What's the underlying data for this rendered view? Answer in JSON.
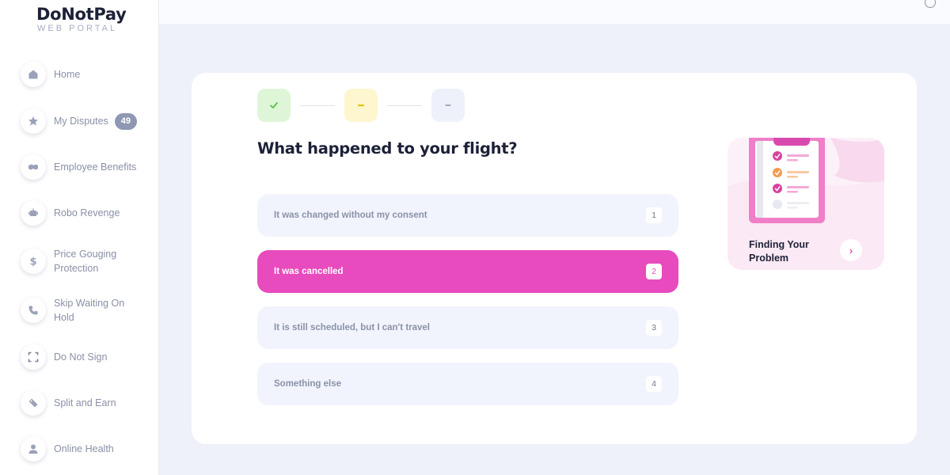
{
  "brand": {
    "name": "DoNotPay",
    "subtitle": "WEB PORTAL"
  },
  "sidebar": {
    "items": [
      {
        "label": "Home",
        "icon": "home-icon"
      },
      {
        "label": "My Disputes",
        "icon": "star-icon",
        "badge": "49"
      },
      {
        "label": "Employee Benefits",
        "icon": "handshake-icon"
      },
      {
        "label": "Robo Revenge",
        "icon": "robot-icon"
      },
      {
        "label": "Price Gouging Protection",
        "icon": "dollar-icon"
      },
      {
        "label": "Skip Waiting On Hold",
        "icon": "phone-icon"
      },
      {
        "label": "Do Not Sign",
        "icon": "scan-icon"
      },
      {
        "label": "Split and Earn",
        "icon": "tag-icon"
      },
      {
        "label": "Online Health",
        "icon": "person-icon"
      }
    ]
  },
  "wizard": {
    "steps": [
      {
        "state": "done",
        "icon": "check-icon",
        "color": "#dff5d8"
      },
      {
        "state": "current",
        "icon": "dash-icon",
        "color": "#fdf6cf"
      },
      {
        "state": "pending",
        "icon": "dash-icon",
        "color": "#eef1fa"
      }
    ],
    "question": "What happened to your flight?",
    "options": [
      {
        "label": "It was changed without my consent",
        "number": "1",
        "selected": false
      },
      {
        "label": "It was cancelled",
        "number": "2",
        "selected": true
      },
      {
        "label": "It is still scheduled, but I can't travel",
        "number": "3",
        "selected": false
      },
      {
        "label": "Something else",
        "number": "4",
        "selected": false
      }
    ]
  },
  "help_card": {
    "title": "Finding Your Problem",
    "icon": "clipboard-icon",
    "arrow_icon": "chevron-right-icon"
  },
  "colors": {
    "accent": "#e84bbd",
    "text_dark": "#1d2138",
    "muted": "#8b92a8",
    "background": "#eef1fa"
  }
}
